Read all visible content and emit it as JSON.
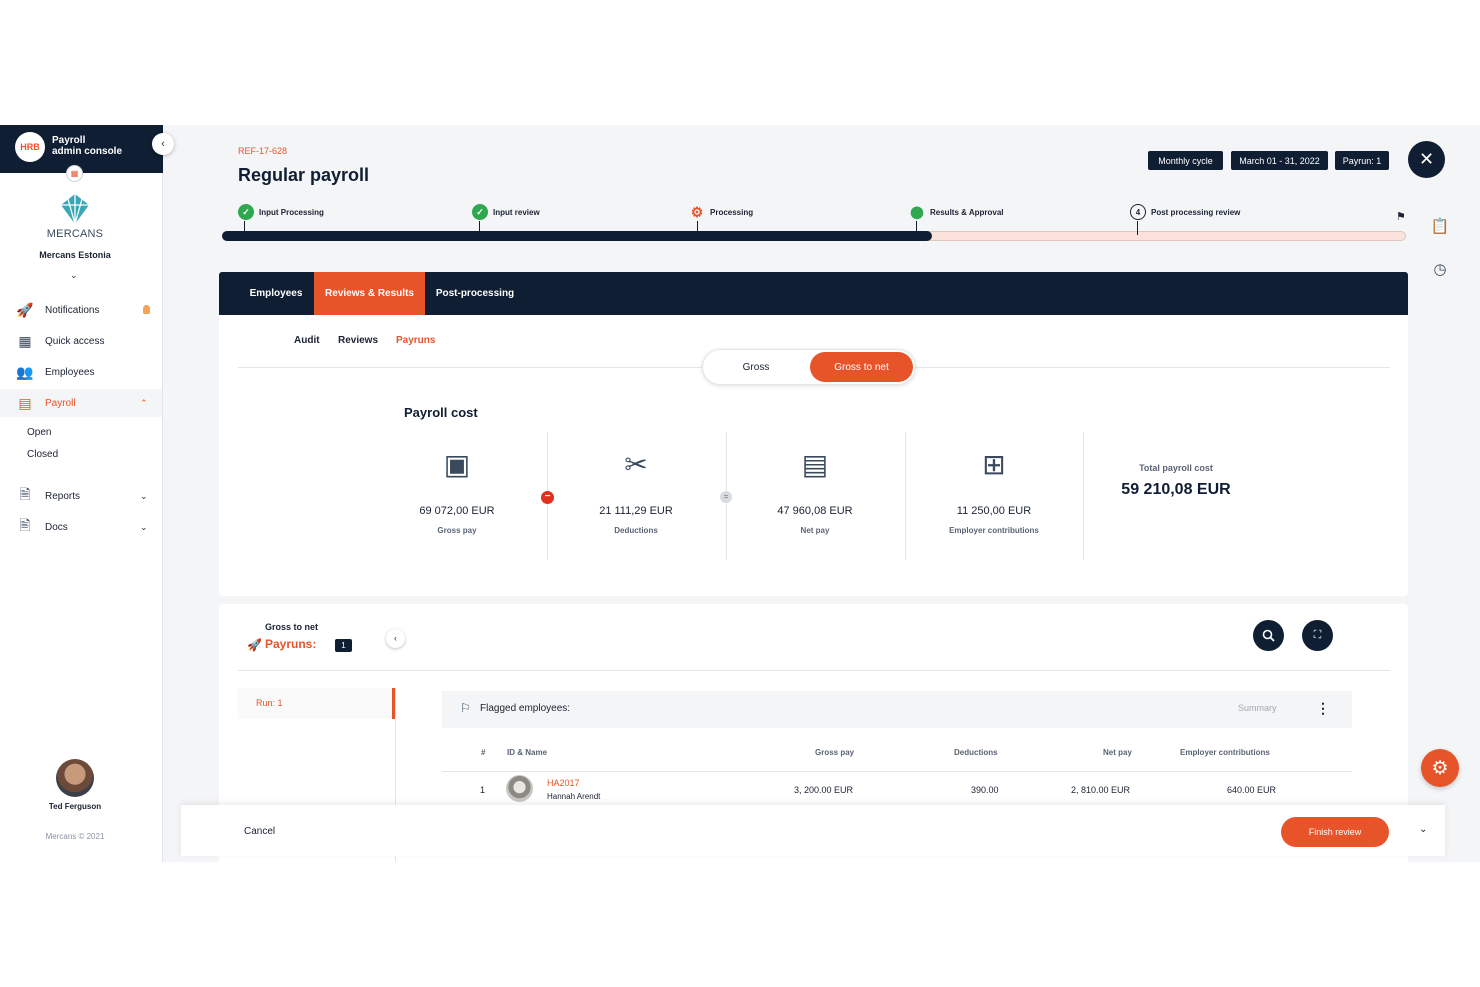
{
  "sidebar": {
    "title": "Payroll\nadmin console",
    "logo_text": "HRB",
    "brand": "MERCANS",
    "company": "Mercans Estonia",
    "items": [
      {
        "label": "Notifications",
        "icon": "rocket-icon"
      },
      {
        "label": "Quick access",
        "icon": "grid-icon"
      },
      {
        "label": "Employees",
        "icon": "people-icon"
      },
      {
        "label": "Payroll",
        "icon": "calculator-icon"
      },
      {
        "label": "Reports",
        "icon": "report-icon"
      },
      {
        "label": "Docs",
        "icon": "docs-icon"
      }
    ],
    "payroll_sub": [
      "Open",
      "Closed"
    ],
    "user_name": "Ted Ferguson",
    "copyright": "Mercans © 2021"
  },
  "header": {
    "ref": "REF-17-628",
    "title": "Regular payroll",
    "chips": [
      "Monthly cycle",
      "March 01 - 31, 2022",
      "Payrun: 1"
    ]
  },
  "steps": [
    {
      "label": "Input Processing",
      "state": "done"
    },
    {
      "label": "Input review",
      "state": "done"
    },
    {
      "label": "Processing",
      "state": "active"
    },
    {
      "label": "Results & Approval",
      "state": "pin"
    },
    {
      "label": "Post processing review",
      "state": "number",
      "number": "4"
    }
  ],
  "progress": 0.6,
  "tabs": [
    "Employees",
    "Reviews & Results",
    "Post-processing"
  ],
  "subtabs": [
    "Audit",
    "Reviews",
    "Payruns"
  ],
  "toggle": {
    "options": [
      "Gross",
      "Gross to net"
    ],
    "selected": "Gross to net"
  },
  "cost": {
    "title": "Payroll cost",
    "metrics": [
      {
        "value": "69 072,00 EUR",
        "label": "Gross pay"
      },
      {
        "value": "21 111,29 EUR",
        "label": "Deductions"
      },
      {
        "value": "47 960,08 EUR",
        "label": "Net pay"
      },
      {
        "value": "11 250,00 EUR",
        "label": "Employer contributions"
      }
    ],
    "total_label": "Total payroll cost",
    "total_value": "59 210,08 EUR"
  },
  "gross_to_net": {
    "title": "Gross to net",
    "payruns_label": "Payruns:",
    "payruns_count": "1",
    "run_label": "Run: 1",
    "flagged_label": "Flagged employees:",
    "summary_label": "Summary",
    "columns": [
      "#",
      "ID & Name",
      "Gross pay",
      "Deductions",
      "Net pay",
      "Employer contributions"
    ],
    "rows": [
      {
        "num": "1",
        "id": "HA2017",
        "name": "Hannah Arendt",
        "gross": "3, 200.00 EUR",
        "deductions": "390.00",
        "net": "2, 810.00 EUR",
        "employer": "640.00 EUR"
      }
    ]
  },
  "footer": {
    "cancel": "Cancel",
    "finish": "Finish review"
  },
  "colors": {
    "navy": "#0f1e33",
    "accent": "#e8542a",
    "success": "#2fa84f"
  }
}
